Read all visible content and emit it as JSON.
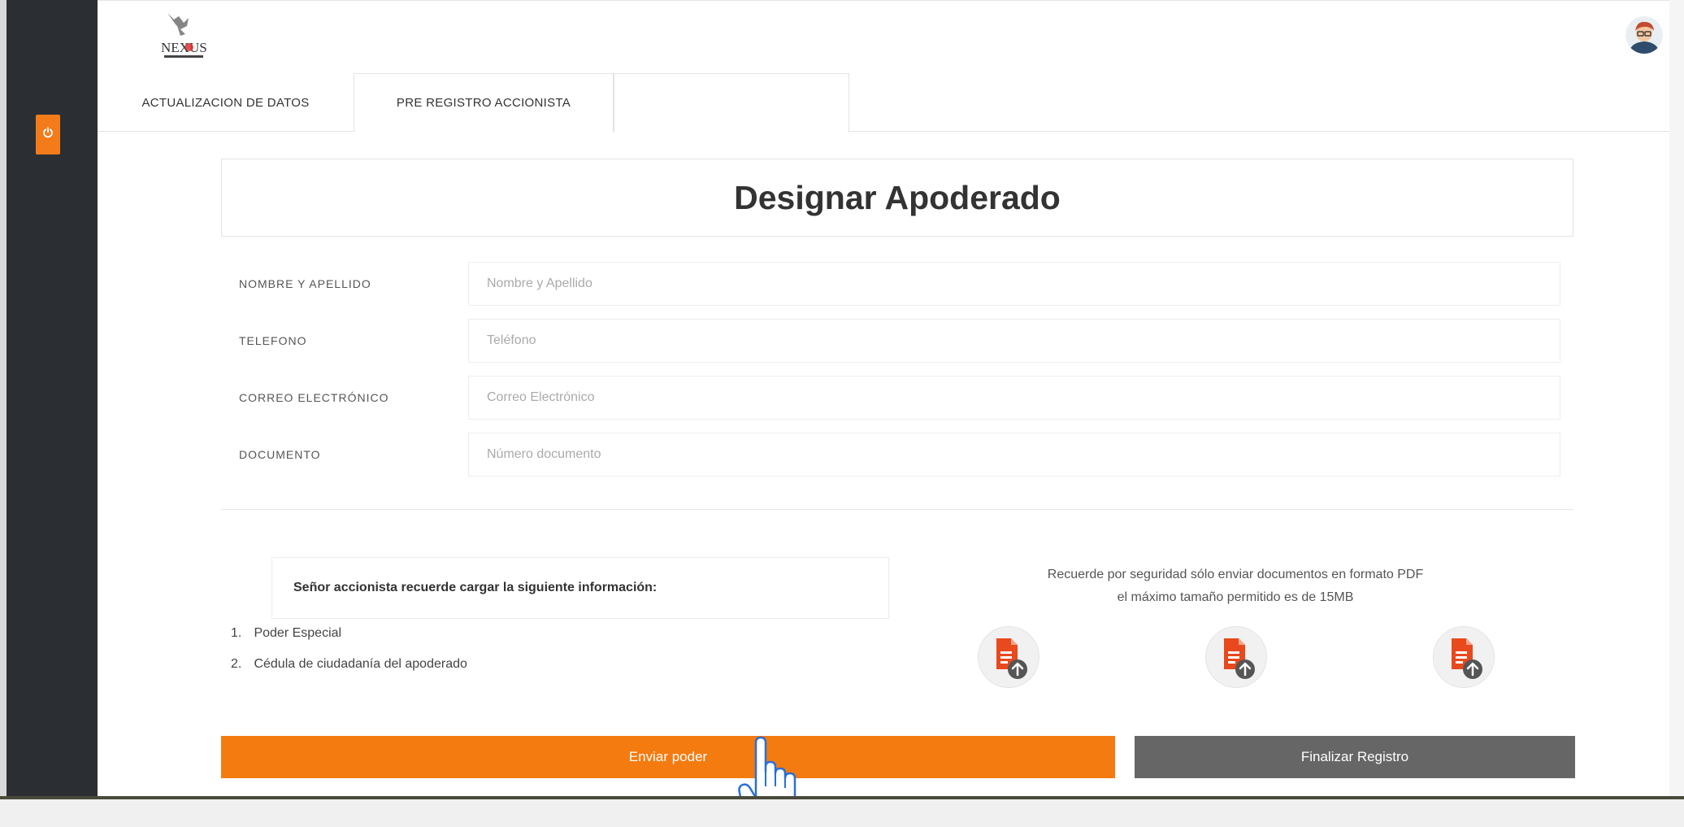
{
  "app": {
    "logo_text": "NEXUS",
    "accent_color": "#f47b10",
    "sidebar_color": "#2b2f33"
  },
  "sidebar": {
    "power_icon": "power-icon"
  },
  "tabs": [
    {
      "label": "ACTUALIZACION DE DATOS"
    },
    {
      "label": "PRE REGISTRO ACCIONISTA"
    },
    {
      "label": ""
    }
  ],
  "form": {
    "title": "Designar Apoderado",
    "fields": [
      {
        "label": "NOMBRE Y APELLIDO",
        "placeholder": "Nombre y Apellido",
        "value": ""
      },
      {
        "label": "TELEFONO",
        "placeholder": "Teléfono",
        "value": ""
      },
      {
        "label": "CORREO ELECTRÓNICO",
        "placeholder": "Correo Electrónico",
        "value": ""
      },
      {
        "label": "DOCUMENTO",
        "placeholder": "Número documento",
        "value": ""
      }
    ]
  },
  "documents": {
    "reminder": "Señor accionista recuerde cargar la siguiente información:",
    "items": [
      {
        "num": "1.",
        "text": "Poder Especial"
      },
      {
        "num": "2.",
        "text": "Cédula de ciudadanía del apoderado"
      }
    ],
    "note_line1": "Recuerde por seguridad sólo enviar documentos en formato PDF",
    "note_line2": "el máximo tamaño permitido es de 15MB",
    "upload_icon": "file-upload-icon"
  },
  "actions": {
    "send_label": "Enviar poder",
    "finish_label": "Finalizar Registro"
  },
  "cursor": {
    "icon": "hand-pointer-icon"
  }
}
